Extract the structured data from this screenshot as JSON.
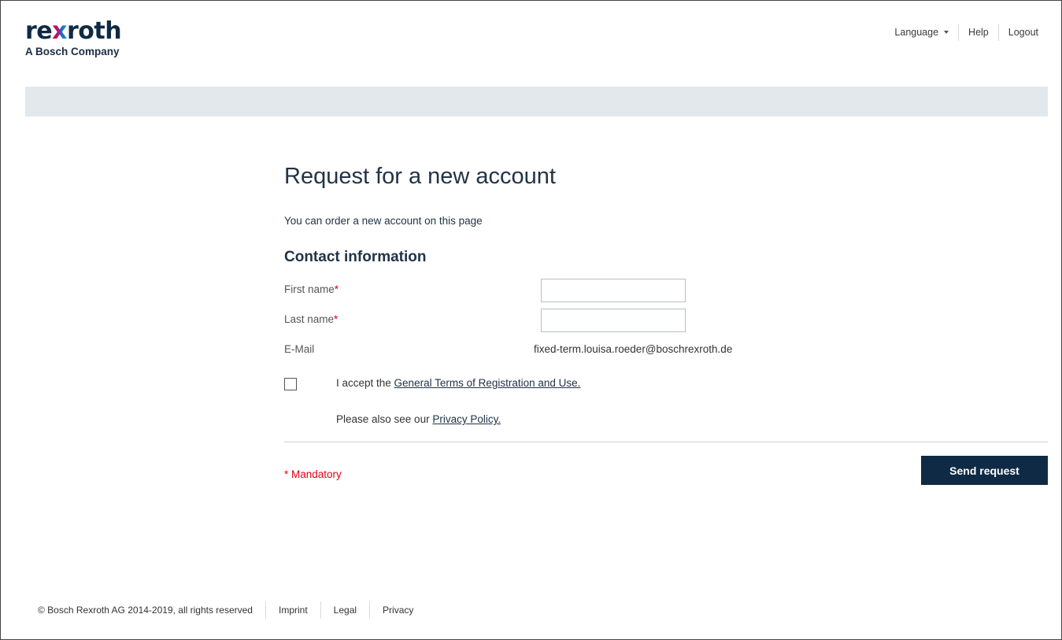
{
  "logo": {
    "word": "rexroth",
    "subtitle": "A Bosch Company"
  },
  "topnav": {
    "language": "Language",
    "help": "Help",
    "logout": "Logout"
  },
  "main": {
    "title": "Request for a new account",
    "intro": "You can order a new account on this page",
    "section_title": "Contact information",
    "fields": {
      "first_name_label": "First name",
      "first_name_value": "",
      "last_name_label": "Last name",
      "last_name_value": "",
      "required_marker": "*",
      "email_label": "E-Mail",
      "email_value": "fixed-term.louisa.roeder@boschrexroth.de"
    },
    "accept": {
      "prefix": "I accept the ",
      "link": "General Terms of Registration and Use.",
      "checked": false
    },
    "privacy": {
      "prefix": "Please also see our ",
      "link": "Privacy Policy."
    },
    "mandatory_note": "* Mandatory",
    "send_button": "Send request"
  },
  "footer": {
    "copyright": "© Bosch Rexroth AG 2014-2019, all rights reserved",
    "imprint": "Imprint",
    "legal": "Legal",
    "privacy": "Privacy"
  },
  "colors": {
    "brand_navy": "#0f2a44",
    "required_red": "#e20015",
    "bar_grey": "#e3e8ec"
  }
}
